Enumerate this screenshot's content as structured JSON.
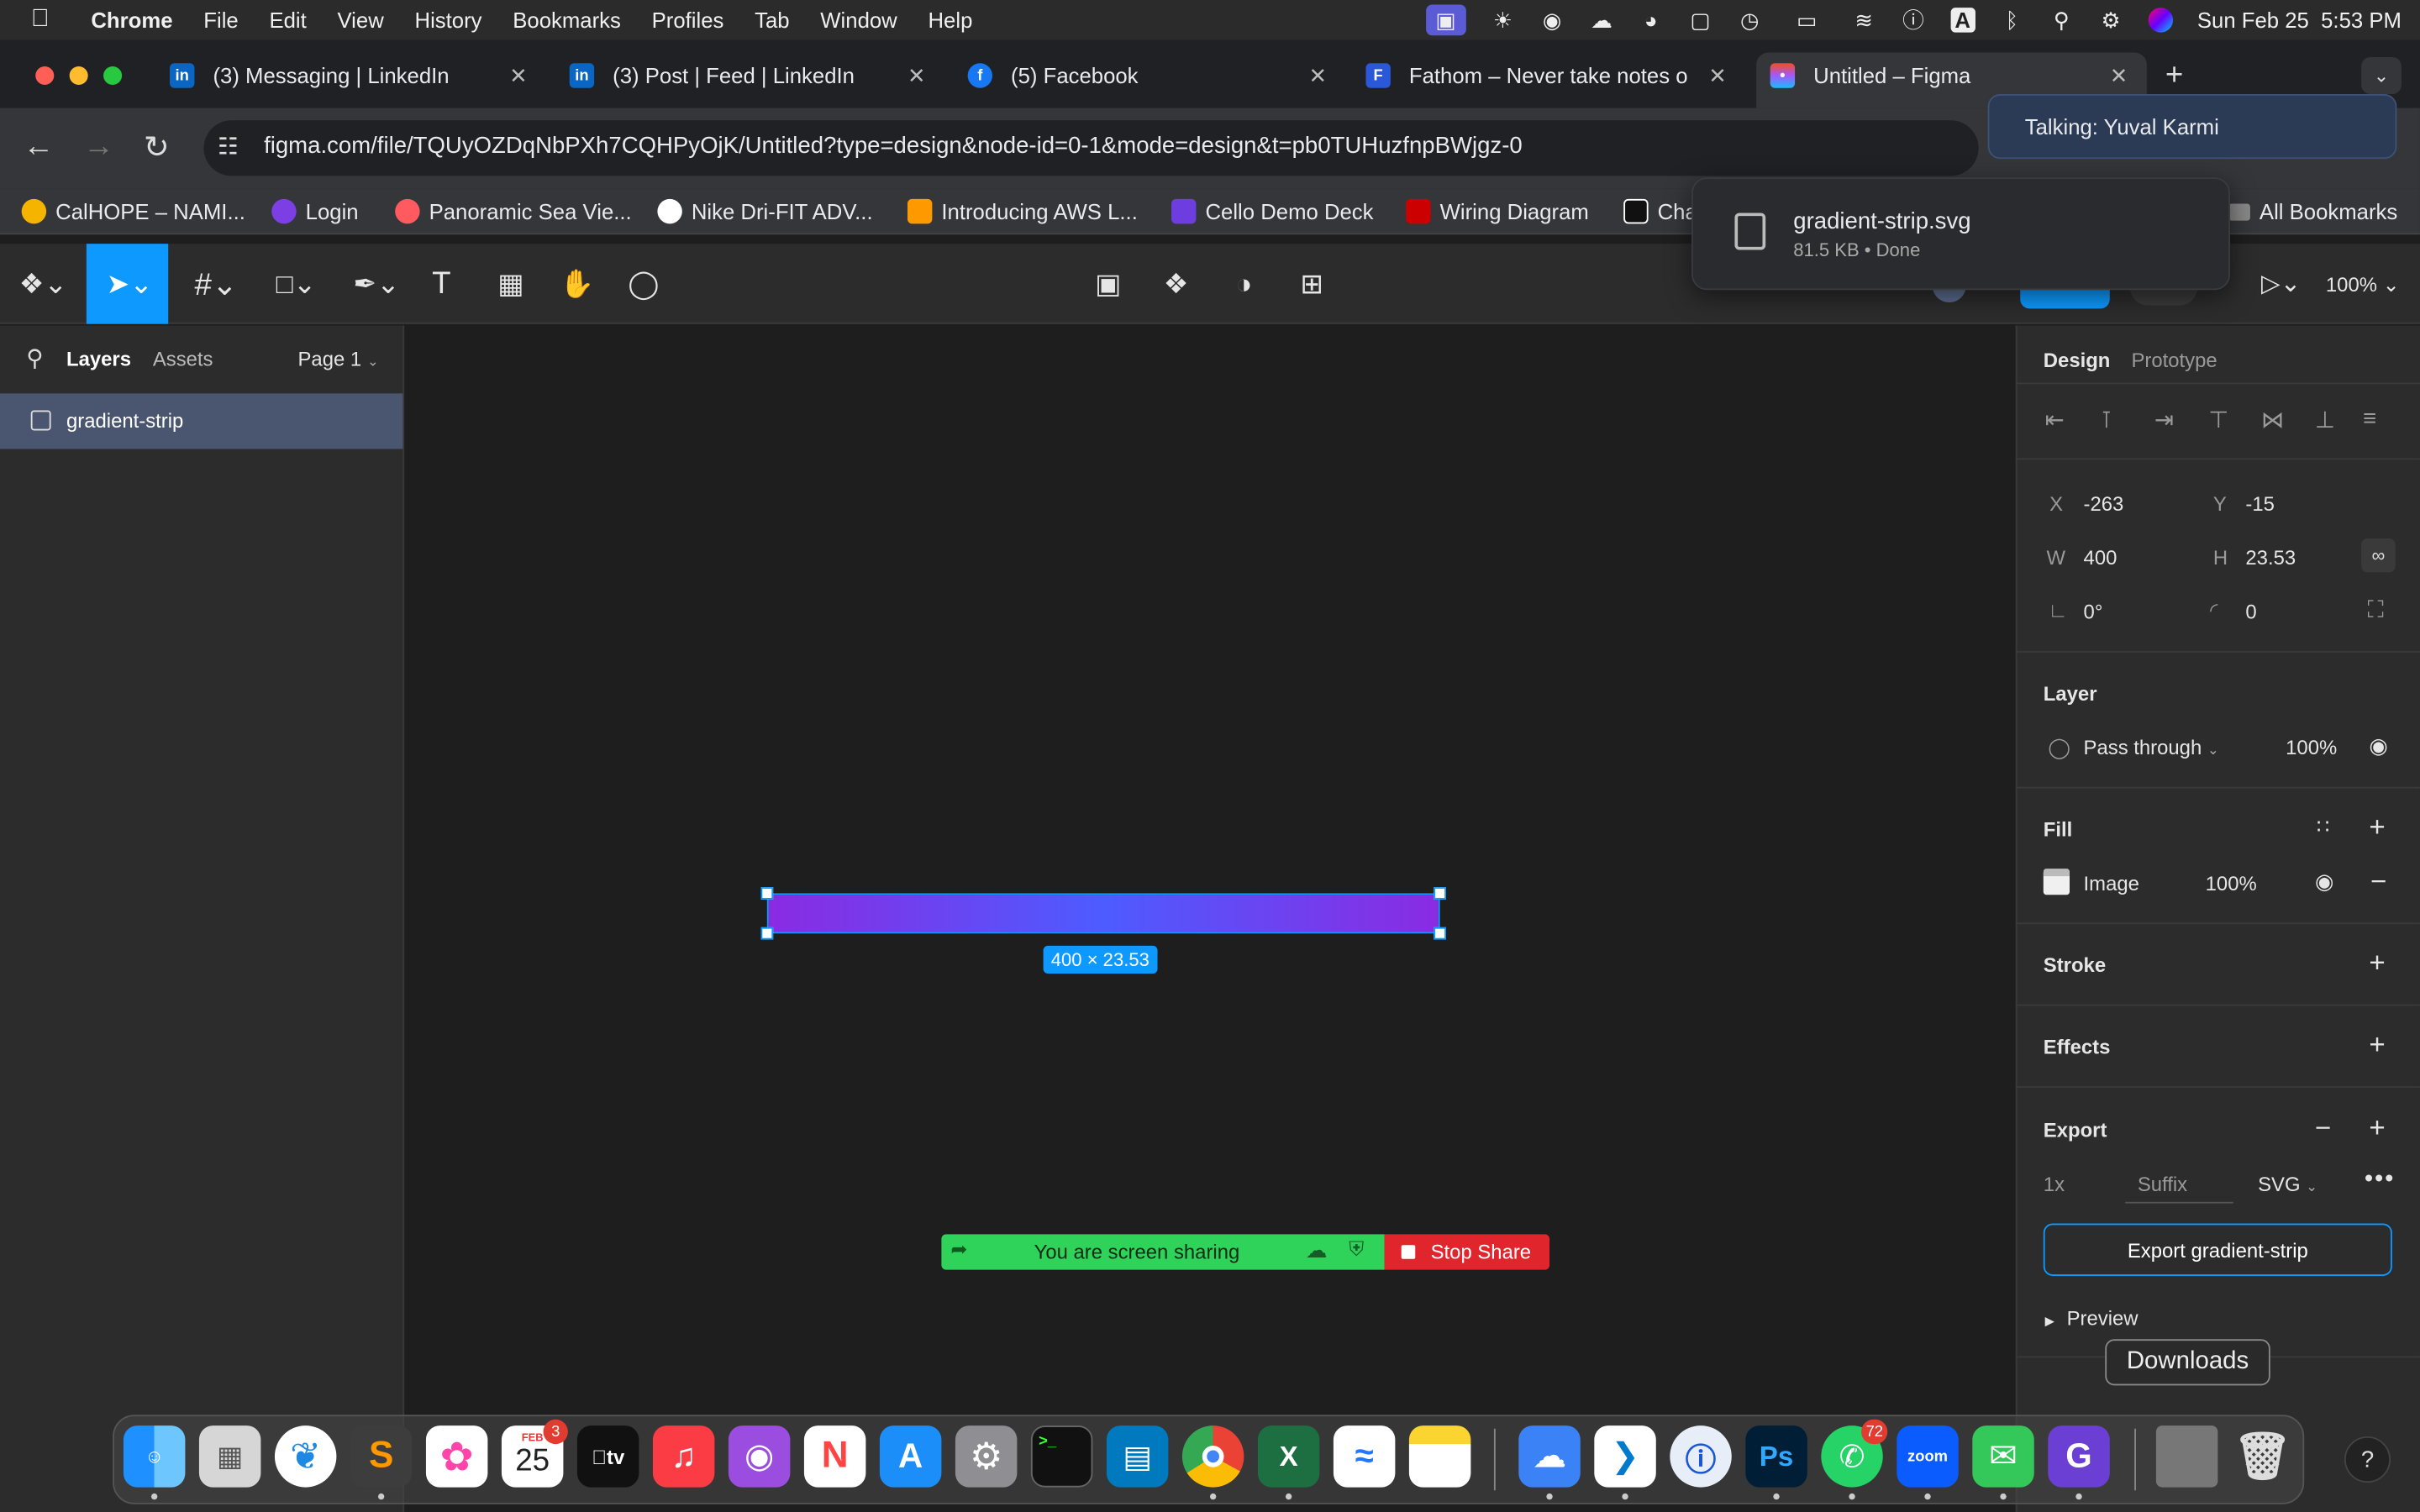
{
  "menubar": {
    "app": "Chrome",
    "items": [
      "File",
      "Edit",
      "View",
      "History",
      "Bookmarks",
      "Profiles",
      "Tab",
      "Window",
      "Help"
    ],
    "clock": "Sun Feb 25  5:53 PM"
  },
  "tabs": [
    {
      "label": "(3) Messaging | LinkedIn",
      "icon": "linkedin-icon"
    },
    {
      "label": "(3) Post | Feed | LinkedIn",
      "icon": "linkedin-icon"
    },
    {
      "label": "(5) Facebook",
      "icon": "facebook-icon"
    },
    {
      "label": "Fathom – Never take notes on",
      "icon": "fathom-icon"
    },
    {
      "label": "Untitled – Figma",
      "icon": "figma-icon",
      "active": true
    }
  ],
  "address": {
    "url": "figma.com/file/TQUyOZDqNbPXh7CQHPyOjK/Untitled?type=design&node-id=0-1&mode=design&t=pb0TUHuzfnpBWjgz-0"
  },
  "bookmarks": {
    "items": [
      "CalHOPE – NAMI...",
      "Login",
      "Panoramic Sea Vie...",
      "Nike Dri-FIT ADV...",
      "Introducing AWS L...",
      "Cello Demo Deck",
      "Wiring Diagram",
      "Cha"
    ],
    "all": "All Bookmarks"
  },
  "popups": {
    "talking": "Talking: Yuval Karmi",
    "download_name": "gradient-strip.svg",
    "download_meta": "81.5 KB • Done"
  },
  "figma": {
    "zoom": "100%",
    "left": {
      "tab_layers": "Layers",
      "tab_assets": "Assets",
      "page": "Page 1",
      "layer": "gradient-strip"
    },
    "canvas": {
      "size_label": "400 × 23.53",
      "gradient_start": "#8a2be2",
      "gradient_end": "#4d5cff"
    },
    "right": {
      "tab_design": "Design",
      "tab_prototype": "Prototype",
      "x_label": "X",
      "x": "-263",
      "y_label": "Y",
      "y": "-15",
      "w_label": "W",
      "w": "400",
      "h_label": "H",
      "h": "23.53",
      "rotation": "0°",
      "radius": "0",
      "layer_title": "Layer",
      "blend": "Pass through",
      "layer_opacity": "100%",
      "fill_title": "Fill",
      "fill_type": "Image",
      "fill_opacity": "100%",
      "stroke_title": "Stroke",
      "effects_title": "Effects",
      "export_title": "Export",
      "export_scale": "1x",
      "export_suffix": "Suffix",
      "export_format": "SVG",
      "export_button": "Export gradient-strip",
      "preview": "Preview"
    },
    "share": {
      "text": "You are screen sharing",
      "stop": "Stop Share"
    }
  },
  "dock": {
    "tooltip": "Downloads",
    "calendar_month": "FEB",
    "calendar_day": "25",
    "calendar_badge": "3",
    "whatsapp_badge": "72"
  }
}
